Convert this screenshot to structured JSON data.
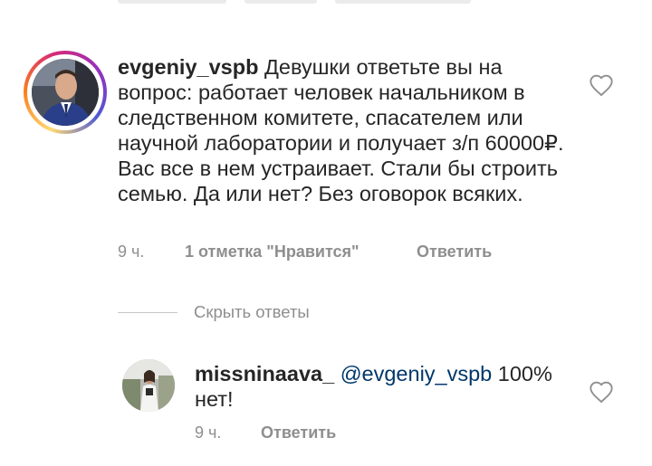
{
  "comment": {
    "username": "evgeniy_vspb",
    "text": "Девушки ответьте вы на вопрос: работает человек начальником в следственном комитете, спасателем или научной лаборатории и получает з/п 60000₽. Вас все в нем устраивает. Стали бы строить семью. Да или нет? Без оговорок всяких.",
    "time": "9 ч.",
    "likes": "1 отметка \"Нравится\"",
    "reply_label": "Ответить",
    "like_icon": "heart-outline-icon"
  },
  "replies_toggle": {
    "label": "Скрыть ответы"
  },
  "reply": {
    "username": "missninaava_",
    "mention": "@evgeniy_vspb",
    "text": "100% нет!",
    "time": "9 ч.",
    "reply_label": "Ответить",
    "like_icon": "heart-outline-icon"
  },
  "colors": {
    "text": "#262626",
    "meta": "#8e8e8e",
    "mention": "#00376b"
  }
}
